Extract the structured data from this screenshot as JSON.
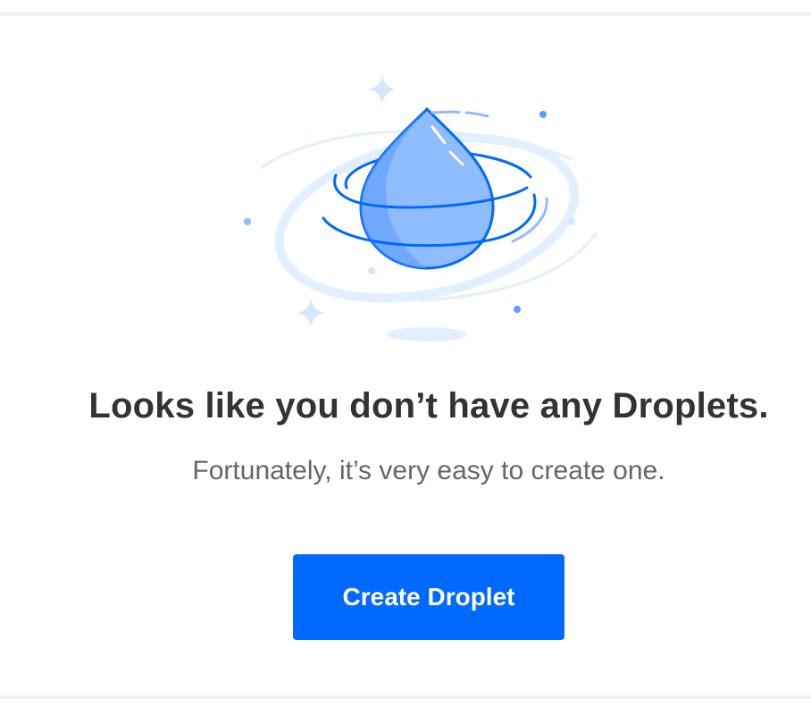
{
  "empty_state": {
    "headline": "Looks like you don’t have any Droplets.",
    "subtext": "Fortunately, it’s very easy to create one.",
    "illustration_icon": "water-droplet-icon"
  },
  "actions": {
    "create_label": "Create Droplet"
  },
  "colors": {
    "accent": "#0069ff",
    "headline": "#333333",
    "subtext": "#666666",
    "droplet_fill": "#8fbcff",
    "droplet_stroke": "#0069ff",
    "ring_light": "#e2efff"
  }
}
